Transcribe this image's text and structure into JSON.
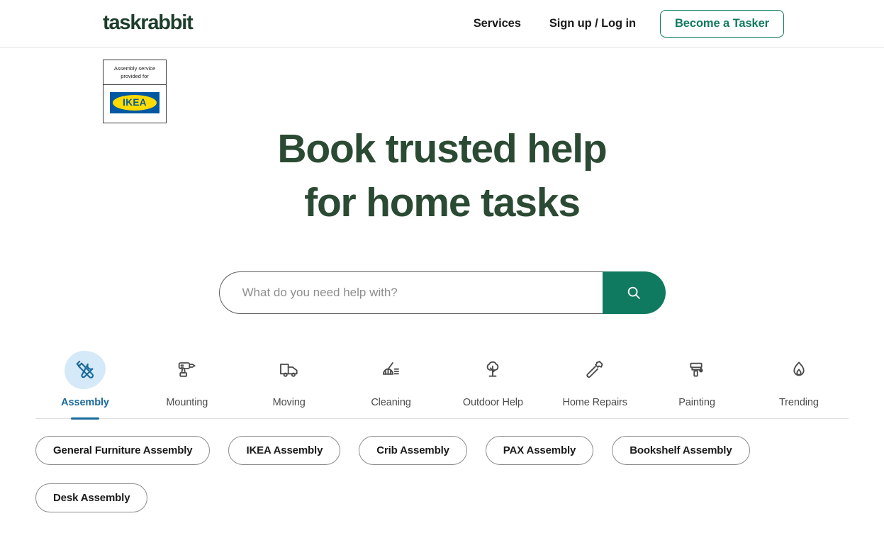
{
  "brand": {
    "logo_text": "taskrabbit",
    "logo_color": "#1d3d2b",
    "accent_green": "#0f7a5f",
    "heading_green": "#2b4a33",
    "active_blue": "#1b6a9c",
    "blob_blue": "#d5e9f8"
  },
  "header": {
    "nav": [
      {
        "label": "Services",
        "name": "nav-services"
      },
      {
        "label": "Sign up / Log in",
        "name": "nav-signup-login"
      }
    ],
    "cta_label": "Become a Tasker"
  },
  "badge": {
    "line1": "Assembly service",
    "line2": "provided for",
    "partner": "IKEA",
    "partner_blue": "#0058a3",
    "partner_yellow": "#ffdb00"
  },
  "hero": {
    "line1": "Book trusted help",
    "line2": "for home tasks"
  },
  "search": {
    "placeholder": "What do you need help with?",
    "value": "",
    "button_icon": "search-icon"
  },
  "categories": [
    {
      "label": "Assembly",
      "icon": "tools-icon",
      "active": true
    },
    {
      "label": "Mounting",
      "icon": "drill-icon",
      "active": false
    },
    {
      "label": "Moving",
      "icon": "truck-icon",
      "active": false
    },
    {
      "label": "Cleaning",
      "icon": "broom-icon",
      "active": false
    },
    {
      "label": "Outdoor Help",
      "icon": "tree-icon",
      "active": false
    },
    {
      "label": "Home Repairs",
      "icon": "hammer-icon",
      "active": false
    },
    {
      "label": "Painting",
      "icon": "paint-roller-icon",
      "active": false
    },
    {
      "label": "Trending",
      "icon": "flame-icon",
      "active": false
    }
  ],
  "chips": [
    {
      "label": "General Furniture Assembly"
    },
    {
      "label": "IKEA Assembly"
    },
    {
      "label": "Crib Assembly"
    },
    {
      "label": "PAX Assembly"
    },
    {
      "label": "Bookshelf Assembly"
    },
    {
      "label": "Desk Assembly"
    }
  ]
}
